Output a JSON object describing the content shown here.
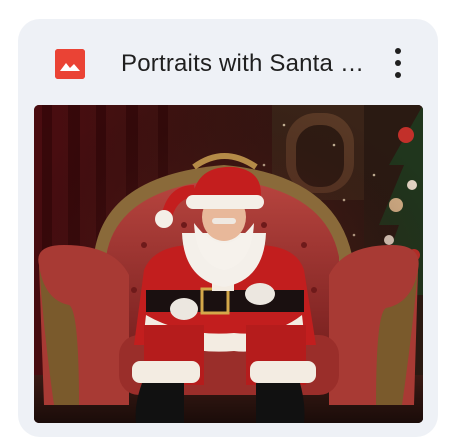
{
  "file": {
    "title": "Portraits with Santa Claus",
    "type_icon": "image-icon",
    "icon_color": "#ea4335",
    "thumbnail_alt": "Santa Claus seated in a red velvet armchair",
    "menu_icon": "more-vert-icon"
  },
  "colors": {
    "card_background": "#eef1f6",
    "title_text": "#1f1f1f"
  }
}
